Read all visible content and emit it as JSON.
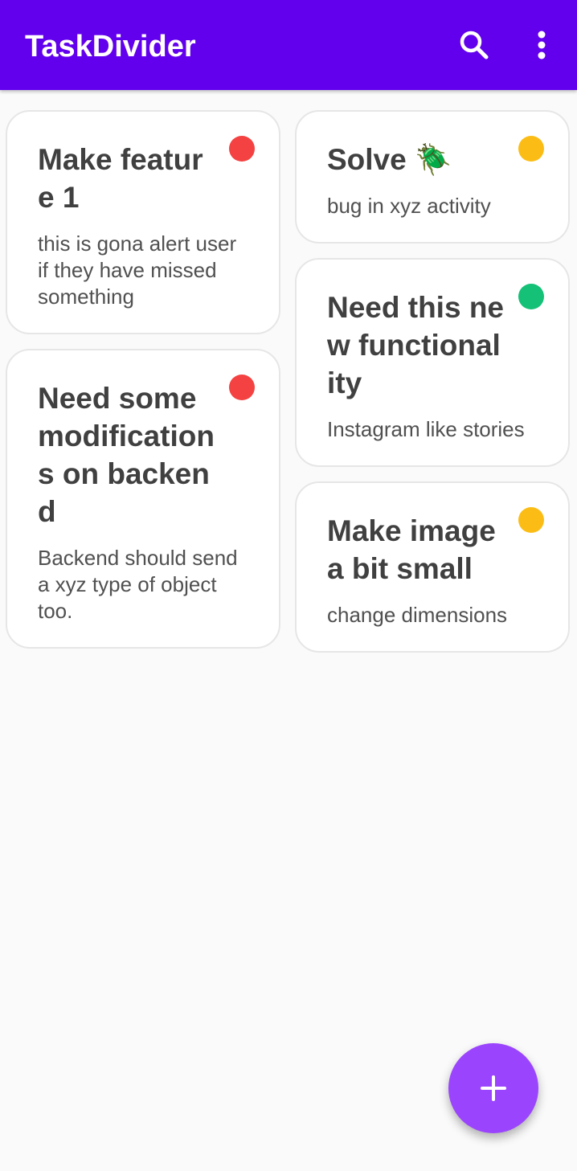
{
  "app_bar": {
    "title": "TaskDivider",
    "color": "#6200ee",
    "search_icon": "search-icon",
    "menu_icon": "more-vertical-icon"
  },
  "priority_colors": {
    "high": "#f44141",
    "medium": "#fbbd15",
    "low": "#14c176"
  },
  "tasks": [
    {
      "title": "Make feature 1",
      "description": "this is gona alert user if they have missed something",
      "priority": "high"
    },
    {
      "title": "Need some modifications on backend",
      "description": "Backend should send a xyz type of object too.",
      "priority": "high"
    },
    {
      "title": "Solve 🪲",
      "description": "bug in xyz activity",
      "priority": "medium"
    },
    {
      "title": "Need this new functionality",
      "description": "Instagram like stories",
      "priority": "low"
    },
    {
      "title": "Make image a bit small",
      "description": "change dimensions",
      "priority": "medium"
    }
  ],
  "fab": {
    "icon": "plus-icon",
    "color": "#9b44fd"
  }
}
